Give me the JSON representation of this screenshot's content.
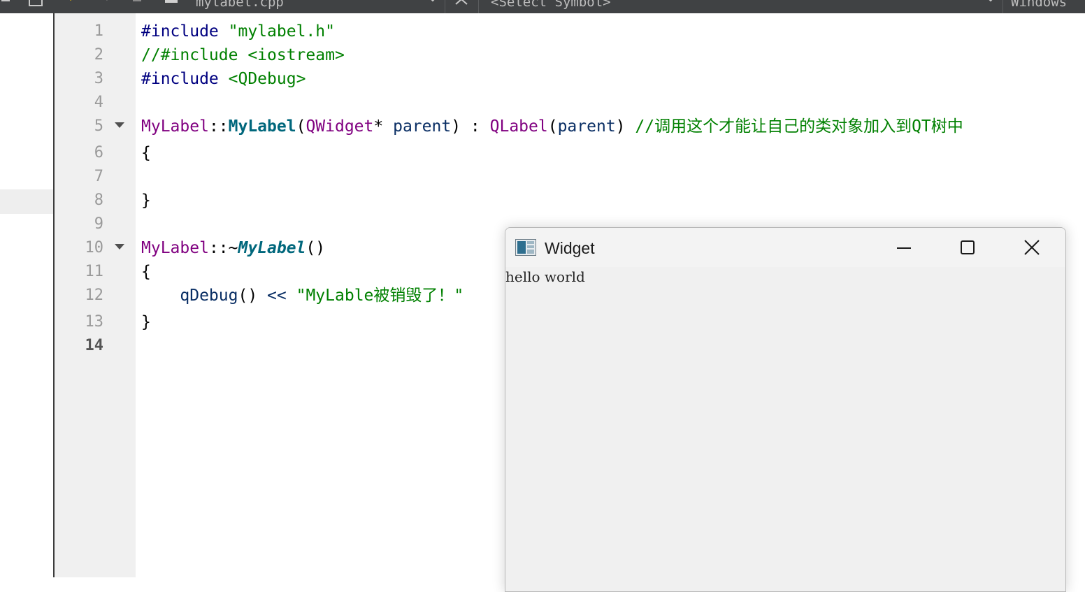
{
  "toolbar": {
    "file_name": "mylabel.cpp",
    "symbol_selector": "<Select Symbol>",
    "line_ending": "Windows"
  },
  "editor": {
    "current_line": 14,
    "lines": [
      {
        "num": "1",
        "fold": false
      },
      {
        "num": "2",
        "fold": false
      },
      {
        "num": "3",
        "fold": false
      },
      {
        "num": "4",
        "fold": false
      },
      {
        "num": "5",
        "fold": true
      },
      {
        "num": "6",
        "fold": false
      },
      {
        "num": "7",
        "fold": false
      },
      {
        "num": "8",
        "fold": false
      },
      {
        "num": "9",
        "fold": false
      },
      {
        "num": "10",
        "fold": true
      },
      {
        "num": "11",
        "fold": false
      },
      {
        "num": "12",
        "fold": false
      },
      {
        "num": "13",
        "fold": false
      },
      {
        "num": "14",
        "fold": false
      }
    ],
    "code": {
      "l1_directive": "#include",
      "l1_file": "\"mylabel.h\"",
      "l2_comment": "//#include <iostream>",
      "l3_directive": "#include",
      "l3_file": "<QDebug>",
      "l5_class": "MyLabel",
      "l5_scope": "::",
      "l5_ctor": "MyLabel",
      "l5_paren_open": "(",
      "l5_param_type": "QWidget",
      "l5_star": "*",
      "l5_param": "parent",
      "l5_paren_close": ")",
      "l5_colon": ":",
      "l5_base": "QLabel",
      "l5_base_open": "(",
      "l5_base_arg": "parent",
      "l5_base_close": ")",
      "l5_comment": "//调用这个才能让自己的类对象加入到QT树中",
      "l6": "{",
      "l8": "}",
      "l10_class": "MyLabel",
      "l10_scope": "::~",
      "l10_dtor": "MyLabel",
      "l10_parens": "()",
      "l11": "{",
      "l12_fn": "qDebug",
      "l12_parens": "()",
      "l12_op": "<<",
      "l12_str": "\"MyLable被销毁了！\"",
      "l13": "}"
    }
  },
  "widget_window": {
    "title": "Widget",
    "label_text": "hello world",
    "minimize_icon": "minimize-icon",
    "maximize_icon": "maximize-icon",
    "close_icon": "close-icon"
  }
}
